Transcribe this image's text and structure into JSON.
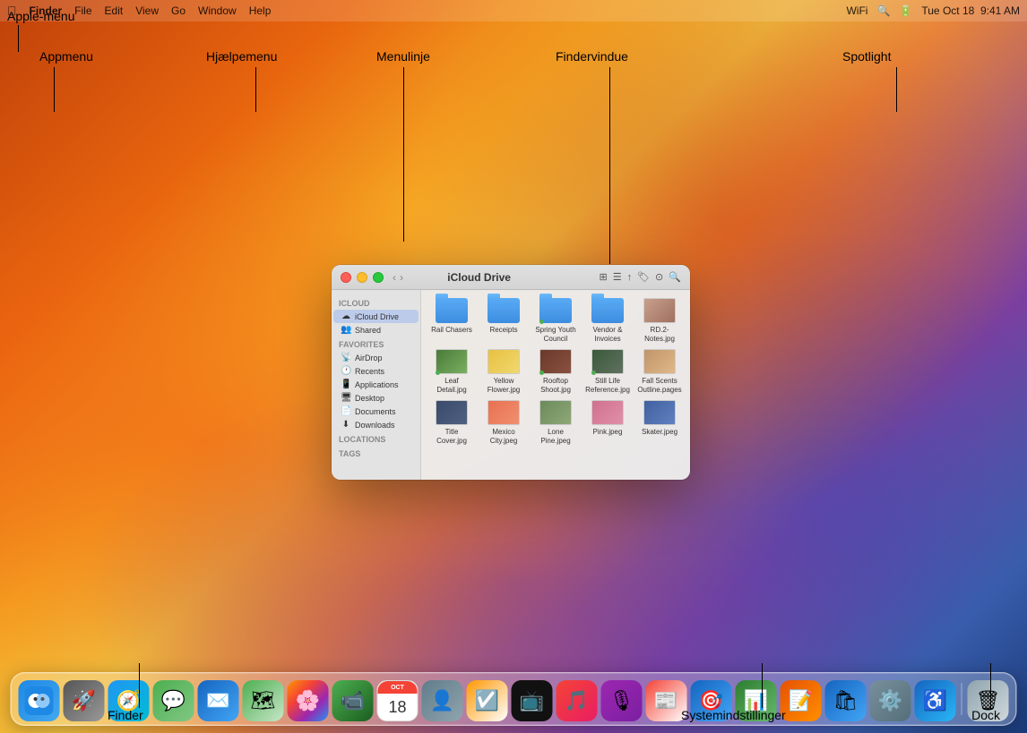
{
  "annotations": {
    "apple_menu": "Apple-menu",
    "appmenu": "Appmenu",
    "hjaelpemenu": "Hjælpemenu",
    "menulinje": "Menulinje",
    "findervindue": "Findervindue",
    "spotlight": "Spotlight",
    "finder": "Finder",
    "systemindstillinger": "Systemindstillinger",
    "dock": "Dock"
  },
  "menubar": {
    "apple": "⌘",
    "items": [
      "Finder",
      "File",
      "Edit",
      "View",
      "Go",
      "Window",
      "Help"
    ],
    "right_items": [
      "WiFi",
      "Search",
      "Battery",
      "Tue Oct 18  9:41 AM"
    ]
  },
  "finder_window": {
    "title": "iCloud Drive",
    "sidebar_sections": [
      {
        "header": "iCloud",
        "items": [
          {
            "icon": "☁",
            "label": "iCloud Drive",
            "active": true
          },
          {
            "icon": "👥",
            "label": "Shared"
          }
        ]
      },
      {
        "header": "Favorites",
        "items": [
          {
            "icon": "📡",
            "label": "AirDrop"
          },
          {
            "icon": "🕐",
            "label": "Recents"
          },
          {
            "icon": "📱",
            "label": "Applications"
          },
          {
            "icon": "🖥",
            "label": "Desktop"
          },
          {
            "icon": "📄",
            "label": "Documents"
          },
          {
            "icon": "⬇",
            "label": "Downloads"
          }
        ]
      },
      {
        "header": "Locations",
        "items": []
      },
      {
        "header": "Tags",
        "items": []
      }
    ],
    "files": [
      {
        "name": "Rail Chasers",
        "type": "folder"
      },
      {
        "name": "Receipts",
        "type": "folder"
      },
      {
        "name": "Spring Youth Council",
        "type": "folder",
        "dot": true
      },
      {
        "name": "Vendor & Invoices",
        "type": "folder"
      },
      {
        "name": "RD.2-Notes.jpg",
        "type": "image",
        "color": "#c8a08c"
      },
      {
        "name": "Leaf Detail.jpg",
        "type": "image",
        "color": "#4a7a3a",
        "dot": true
      },
      {
        "name": "Yellow Flower.jpg",
        "type": "image",
        "color": "#e8c040"
      },
      {
        "name": "Rooftop Shoot.jpg",
        "type": "image",
        "color": "#6a3a2a",
        "dot": true
      },
      {
        "name": "Still Life Reference.jpg",
        "type": "image",
        "color": "#3a5a3a",
        "dot": true
      },
      {
        "name": "Fall Scents Outline.pages",
        "type": "image",
        "color": "#c0956a"
      },
      {
        "name": "Title Cover.jpg",
        "type": "image",
        "color": "#3a4a6a"
      },
      {
        "name": "Mexico City.jpeg",
        "type": "image",
        "color": "#e87050"
      },
      {
        "name": "Lone Pine.jpeg",
        "type": "image",
        "color": "#6a8a5a"
      },
      {
        "name": "Pink.jpeg",
        "type": "image",
        "color": "#d07090"
      },
      {
        "name": "Skater.jpeg",
        "type": "image",
        "color": "#4060a0"
      }
    ]
  },
  "dock": {
    "icons": [
      {
        "name": "finder",
        "emoji": "🔵",
        "label": "Finder",
        "css_class": "dock-finder"
      },
      {
        "name": "launchpad",
        "emoji": "🚀",
        "label": "Launchpad",
        "css_class": "dock-launchpad"
      },
      {
        "name": "safari",
        "emoji": "🧭",
        "label": "Safari",
        "css_class": "dock-safari"
      },
      {
        "name": "messages",
        "emoji": "💬",
        "label": "Messages",
        "css_class": "dock-messages"
      },
      {
        "name": "mail",
        "emoji": "✉️",
        "label": "Mail",
        "css_class": "dock-mail"
      },
      {
        "name": "maps",
        "emoji": "🗺",
        "label": "Maps",
        "css_class": "dock-maps"
      },
      {
        "name": "photos",
        "emoji": "🌸",
        "label": "Photos",
        "css_class": "dock-photos"
      },
      {
        "name": "facetime",
        "emoji": "📹",
        "label": "FaceTime",
        "css_class": "dock-facetime"
      },
      {
        "name": "calendar",
        "emoji": "📅",
        "label": "Calendar",
        "css_class": "dock-calendar",
        "date": "18"
      },
      {
        "name": "contacts",
        "emoji": "👤",
        "label": "Contacts",
        "css_class": "dock-contacts"
      },
      {
        "name": "reminders",
        "emoji": "☑️",
        "label": "Reminders",
        "css_class": "dock-reminders"
      },
      {
        "name": "appletv",
        "emoji": "📺",
        "label": "Apple TV",
        "css_class": "dock-appletv"
      },
      {
        "name": "music",
        "emoji": "🎵",
        "label": "Music",
        "css_class": "dock-music"
      },
      {
        "name": "podcasts",
        "emoji": "🎙",
        "label": "Podcasts",
        "css_class": "dock-podcasts"
      },
      {
        "name": "news",
        "emoji": "📰",
        "label": "News",
        "css_class": "dock-news"
      },
      {
        "name": "keynote",
        "emoji": "🎯",
        "label": "Keynote",
        "css_class": "dock-keynote"
      },
      {
        "name": "numbers",
        "emoji": "📊",
        "label": "Numbers",
        "css_class": "dock-numbers"
      },
      {
        "name": "pages",
        "emoji": "📝",
        "label": "Pages",
        "css_class": "dock-pages"
      },
      {
        "name": "appstore",
        "emoji": "🛍",
        "label": "App Store",
        "css_class": "dock-appstore"
      },
      {
        "name": "settings",
        "emoji": "⚙️",
        "label": "System Settings",
        "css_class": "dock-settings"
      },
      {
        "name": "accessibility",
        "emoji": "♿",
        "label": "Accessibility",
        "css_class": "dock-accessibility"
      },
      {
        "name": "trash",
        "emoji": "🗑",
        "label": "Trash",
        "css_class": "dock-trash"
      }
    ]
  }
}
